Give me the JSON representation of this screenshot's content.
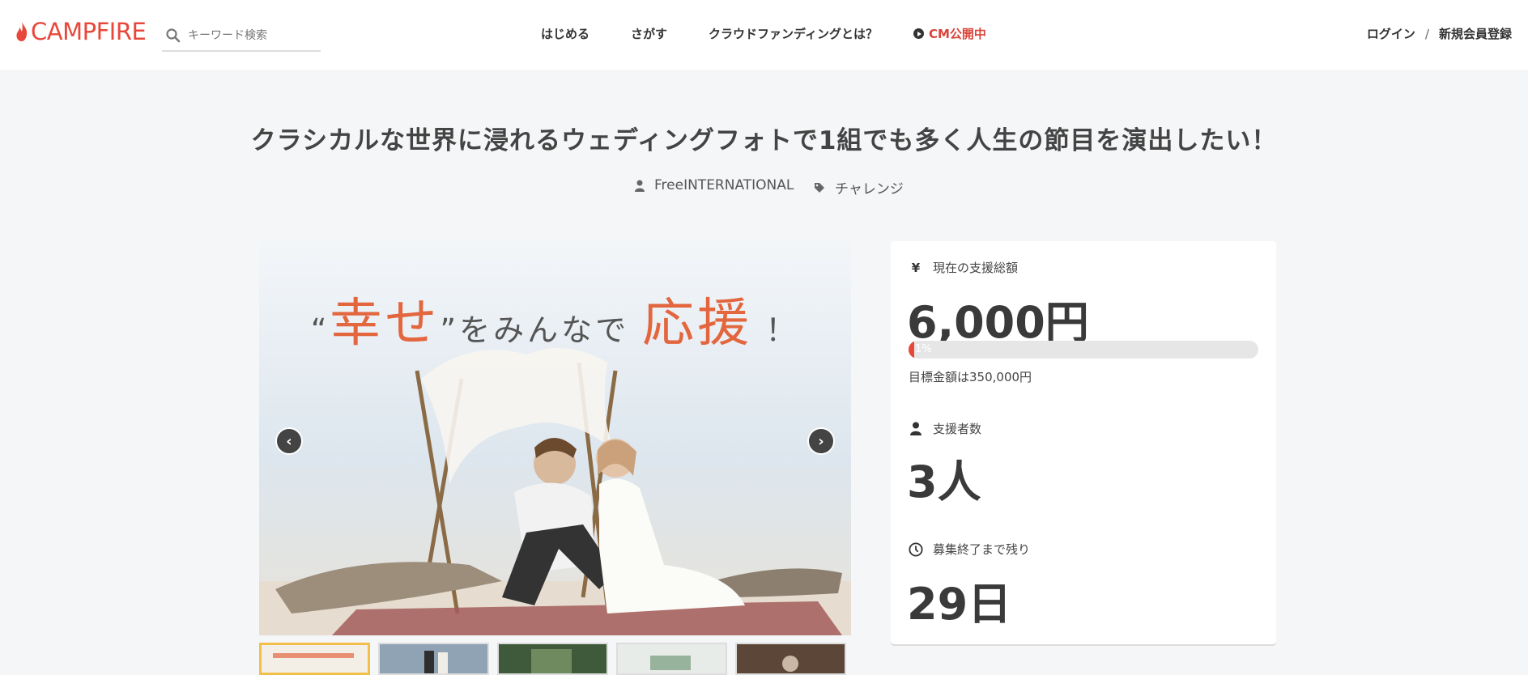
{
  "header": {
    "logo": "CAMPFIRE",
    "search_placeholder": "キーワード検索",
    "nav": [
      "はじめる",
      "さがす",
      "クラウドファンディングとは？"
    ],
    "cm_label": "CM公開中",
    "login": "ログイン",
    "separator": "/",
    "signup": "新規会員登録"
  },
  "project": {
    "title": "クラシカルな世界に浸れるウェディングフォトで1組でも多く人生の節目を演出したい！",
    "owner": "FreeINTERNATIONAL",
    "category": "チャレンジ"
  },
  "gallery": {
    "caption_open": "“",
    "caption_word1": "幸せ",
    "caption_close": "”をみんなで",
    "caption_word2": "応援",
    "caption_end": "！",
    "thumb_count": 5,
    "prev_label": "‹",
    "next_label": "›"
  },
  "stats": {
    "funded_label": "現在の支援総額",
    "funded_icon": "¥",
    "funded_amount": "6,000円",
    "progress_text": "1%",
    "progress_fraction": 0.017,
    "goal_text": "目標金額は350,000円",
    "backers_label": "支援者数",
    "backers_value": "3人",
    "remaining_label": "募集終了まで残り",
    "remaining_value": "29日"
  },
  "colors": {
    "brand": "#e8483b",
    "text": "#333333",
    "accent_photo_text": "#e3663e"
  }
}
